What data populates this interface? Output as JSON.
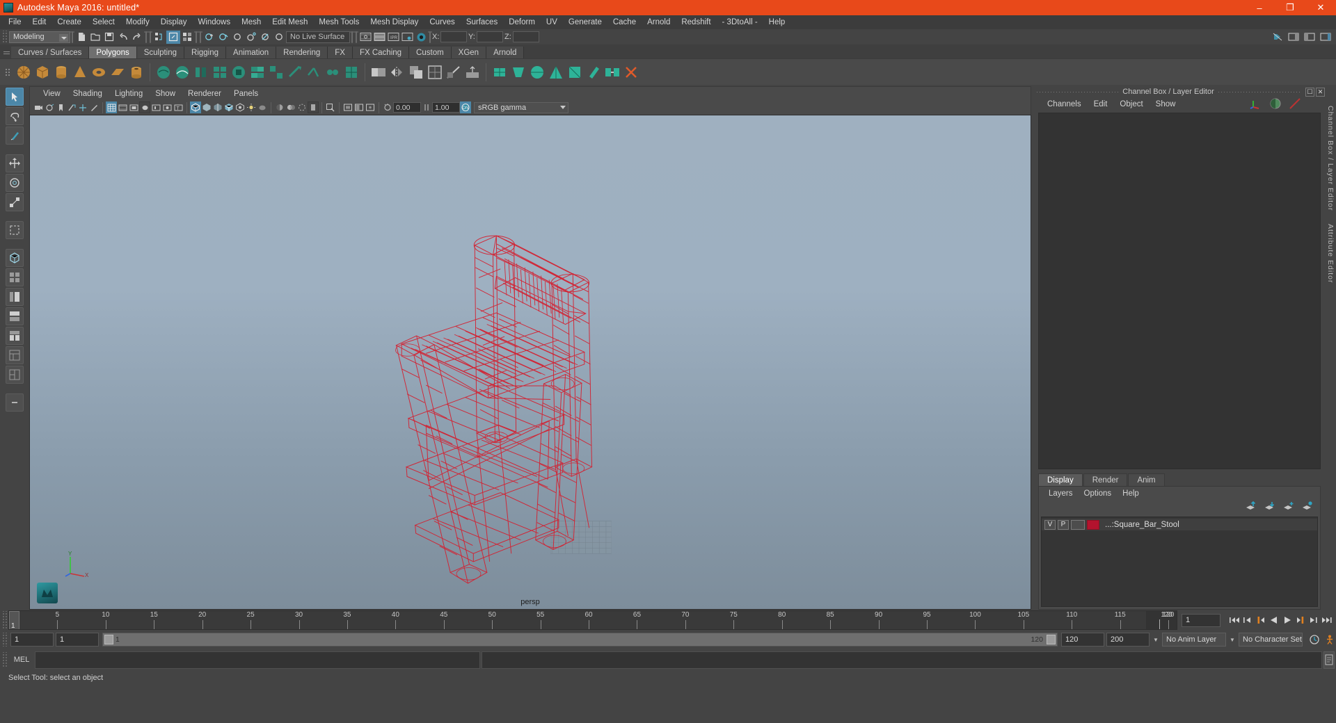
{
  "titlebar": {
    "title": "Autodesk Maya 2016: untitled*",
    "minimize": "–",
    "maximize": "❐",
    "close": "✕"
  },
  "menubar": {
    "items": [
      "File",
      "Edit",
      "Create",
      "Select",
      "Modify",
      "Display",
      "Windows",
      "Mesh",
      "Edit Mesh",
      "Mesh Tools",
      "Mesh Display",
      "Curves",
      "Surfaces",
      "Deform",
      "UV",
      "Generate",
      "Cache",
      "Arnold",
      "Redshift",
      "- 3DtoAll -",
      "Help"
    ]
  },
  "statusline": {
    "selection_mode": "Modeling",
    "live_surface": "No Live Surface",
    "x_label": "X:",
    "y_label": "Y:",
    "z_label": "Z:",
    "x_value": "",
    "y_value": "",
    "z_value": ""
  },
  "shelf": {
    "tabs": [
      "Curves / Surfaces",
      "Polygons",
      "Sculpting",
      "Rigging",
      "Animation",
      "Rendering",
      "FX",
      "FX Caching",
      "Custom",
      "XGen",
      "Arnold"
    ],
    "active_tab": "Polygons"
  },
  "viewport_panel": {
    "menus": [
      "View",
      "Shading",
      "Lighting",
      "Show",
      "Renderer",
      "Panels"
    ],
    "exposure_value": "0.00",
    "gamma_value": "1.00",
    "color_management": "sRGB gamma",
    "camera_label": "persp"
  },
  "channel_box": {
    "title": "Channel Box / Layer Editor",
    "menus": [
      "Channels",
      "Edit",
      "Object",
      "Show"
    ],
    "side_labels": [
      "Channel Box / Layer Editor",
      "Attribute Editor"
    ]
  },
  "layer_editor": {
    "tabs": [
      "Display",
      "Render",
      "Anim"
    ],
    "active_tab": "Display",
    "menus": [
      "Layers",
      "Options",
      "Help"
    ],
    "layers": [
      {
        "visibility": "V",
        "playback": "P",
        "color": "#b3132e",
        "name": "...:Square_Bar_Stool"
      }
    ]
  },
  "timeline": {
    "ticks": [
      5,
      10,
      15,
      20,
      25,
      30,
      35,
      40,
      45,
      50,
      55,
      60,
      65,
      70,
      75,
      80,
      85,
      90,
      95,
      100,
      105,
      110,
      115,
      120
    ],
    "current_frame": "1",
    "end_frame": "120",
    "frame_field": "1"
  },
  "range_slider": {
    "start_field": "1",
    "anim_start_field": "1",
    "range_start": "1",
    "range_end": "120",
    "anim_end_field": "120",
    "playback_end_field": "200",
    "anim_layer": "No Anim Layer",
    "character_set": "No Character Set"
  },
  "command_line": {
    "language": "MEL",
    "command_value": "",
    "output_value": ""
  },
  "status_bar": {
    "message": "Select Tool: select an object"
  },
  "colors": {
    "title_bar": "#e8491a",
    "accent_blue": "#4c87a8",
    "wireframe_red": "#d42030",
    "panel_bg": "#444444"
  },
  "model": {
    "name": "Square_Bar_Stool",
    "wireframe_color": "#d42030"
  }
}
